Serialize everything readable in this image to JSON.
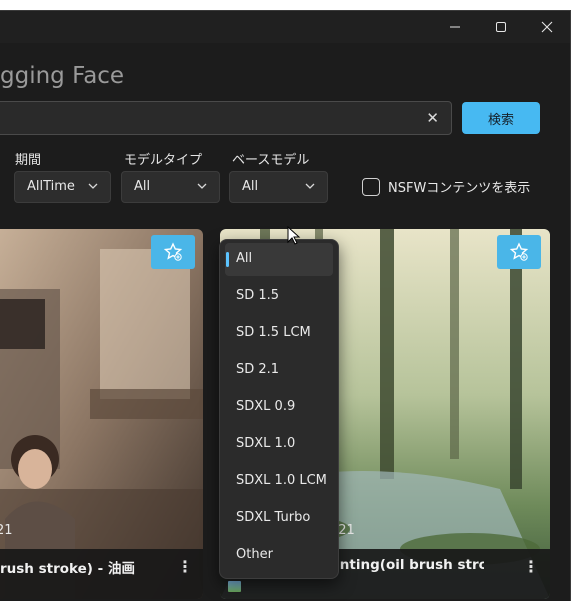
{
  "app": {
    "title": "gging Face"
  },
  "window_controls": {
    "minimize": "minimize",
    "maximize": "maximize",
    "close": "close"
  },
  "search": {
    "value": "",
    "button_label": "検索"
  },
  "filters": {
    "period": {
      "label": "期間",
      "value": "AllTime"
    },
    "model_type": {
      "label": "モデルタイプ",
      "value": "All"
    },
    "base_model": {
      "label": "ベースモデル",
      "value": "All"
    },
    "nsfw": {
      "label": "NSFWコンテンツを表示",
      "checked": false
    }
  },
  "base_model_menu": {
    "items": [
      "All",
      "SD 1.5",
      "SD 1.5 LCM",
      "SD 2.1",
      "SDXL 0.9",
      "SDXL 1.0",
      "SDXL 1.0 LCM",
      "SDXL Turbo",
      "Other"
    ],
    "selected": "All"
  },
  "cards": [
    {
      "title": "rush stroke) - 油画笔",
      "count": "21",
      "menu_icon": "more-vertical-icon"
    },
    {
      "title": "(SDXL)  Oil painting(oil brush strol",
      "count": "421",
      "menu_icon": "more-vertical-icon"
    }
  ],
  "colors": {
    "accent": "#47b9f2",
    "window_bg": "#202020",
    "menu_bg": "#2b2b2b",
    "selected_indicator": "#5cc4ff"
  }
}
